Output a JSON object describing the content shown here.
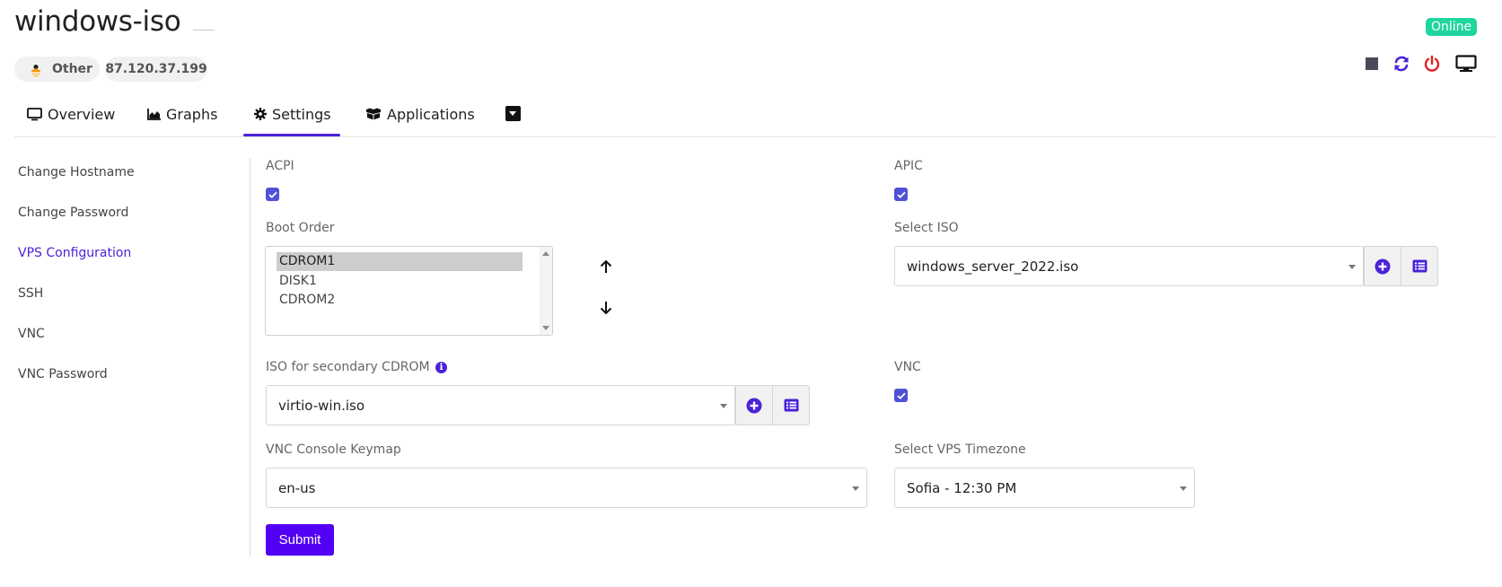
{
  "header": {
    "title": "windows-iso",
    "status": "Online",
    "os_label": "Other",
    "ip": "87.120.37.199",
    "controls": [
      {
        "icon": "stop-square-icon",
        "color": "#4a4a5a"
      },
      {
        "icon": "restart-arrows-icon",
        "color": "#4a22d8"
      },
      {
        "icon": "power-icon",
        "color": "#e02020"
      },
      {
        "icon": "monitor-console-icon",
        "color": "#111111"
      }
    ]
  },
  "tabs": [
    {
      "label": "Overview",
      "icon": "monitor-icon"
    },
    {
      "label": "Graphs",
      "icon": "area-chart-icon"
    },
    {
      "label": "Settings",
      "icon": "gear-icon",
      "active": true
    },
    {
      "label": "Applications",
      "icon": "boxes-icon"
    }
  ],
  "sidebar": {
    "items": [
      {
        "label": "Change Hostname"
      },
      {
        "label": "Change Password"
      },
      {
        "label": "VPS Configuration",
        "active": true
      },
      {
        "label": "SSH"
      },
      {
        "label": "VNC"
      },
      {
        "label": "VNC Password"
      }
    ]
  },
  "form": {
    "acpi": {
      "label": "ACPI",
      "checked": true
    },
    "apic": {
      "label": "APIC",
      "checked": true
    },
    "boot_order": {
      "label": "Boot Order",
      "options": [
        "CDROM1",
        "DISK1",
        "CDROM2"
      ],
      "selected": "CDROM1"
    },
    "select_iso": {
      "label": "Select ISO",
      "value": "windows_server_2022.iso"
    },
    "secondary_iso": {
      "label": "ISO for secondary CDROM",
      "value": "virtio-win.iso"
    },
    "vnc": {
      "label": "VNC",
      "checked": true
    },
    "keymap": {
      "label": "VNC Console Keymap",
      "value": "en-us"
    },
    "timezone": {
      "label": "Select VPS Timezone",
      "value": "Sofia - 12:30 PM"
    },
    "submit_label": "Submit"
  },
  "colors": {
    "accent": "#4a22d8",
    "online": "#1fd69e",
    "checkbox": "#4f51d6",
    "submit": "#5200f5"
  }
}
